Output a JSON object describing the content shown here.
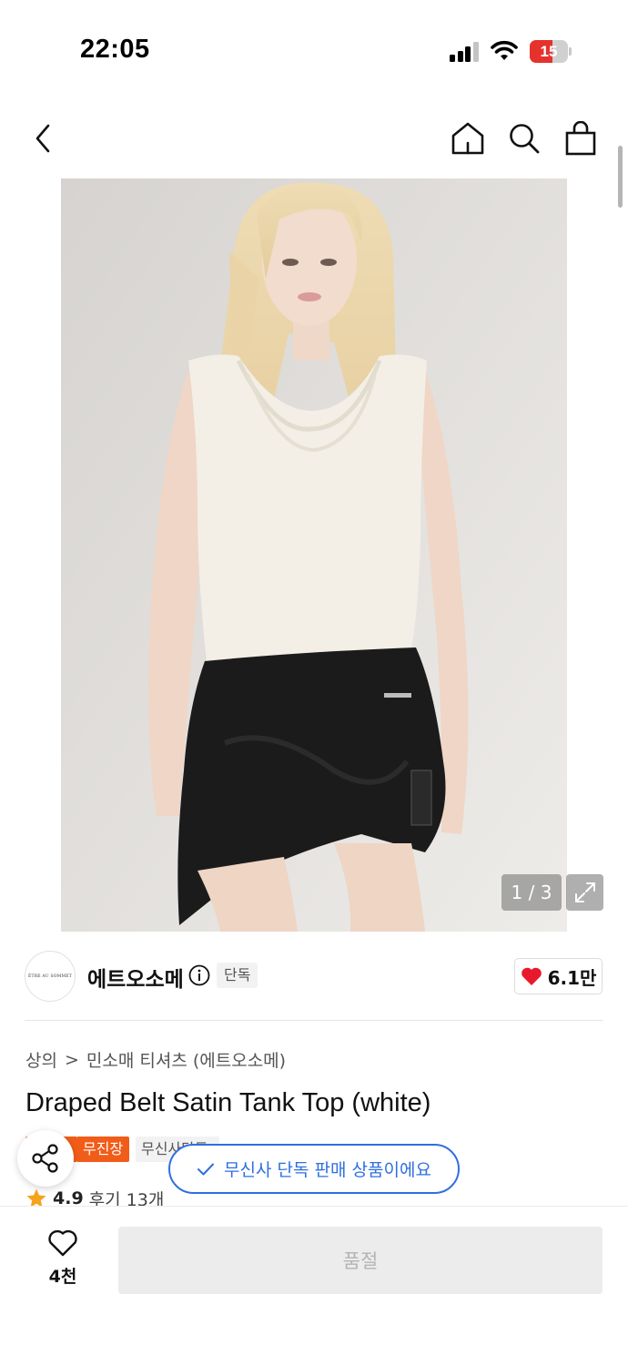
{
  "status_bar": {
    "time": "22:05",
    "battery_percent": "15",
    "battery_color": "#e5322d"
  },
  "nav": {
    "icons": [
      "chevron-left-icon",
      "home-icon",
      "search-icon",
      "shopping-bag-icon"
    ]
  },
  "gallery": {
    "counter": "1 / 3",
    "current_index": 1,
    "total": 3
  },
  "brand": {
    "logo_text": "ÊTRE AU SOMMET",
    "name": "에트오소메",
    "exclusive_badge": "단독",
    "likes": "6.1만"
  },
  "breadcrumb": {
    "category": "상의",
    "separator": ">",
    "subcategory": "민소매 티셔츠 (에트오소메)"
  },
  "product": {
    "title": "Draped Belt Satin Tank Top (white)",
    "tags": [
      "무진장",
      "무신사단독"
    ],
    "rating": "4.9",
    "reviews": "후기 13개"
  },
  "toast": {
    "message": "무신사 단독 판매 상품이에요"
  },
  "bottom_bar": {
    "wish_count": "4천",
    "buy_button_label": "품절"
  },
  "colors": {
    "accent_blue": "#2f6fe0",
    "tag_orange": "#f25c19",
    "heart_red": "#e8192c"
  }
}
